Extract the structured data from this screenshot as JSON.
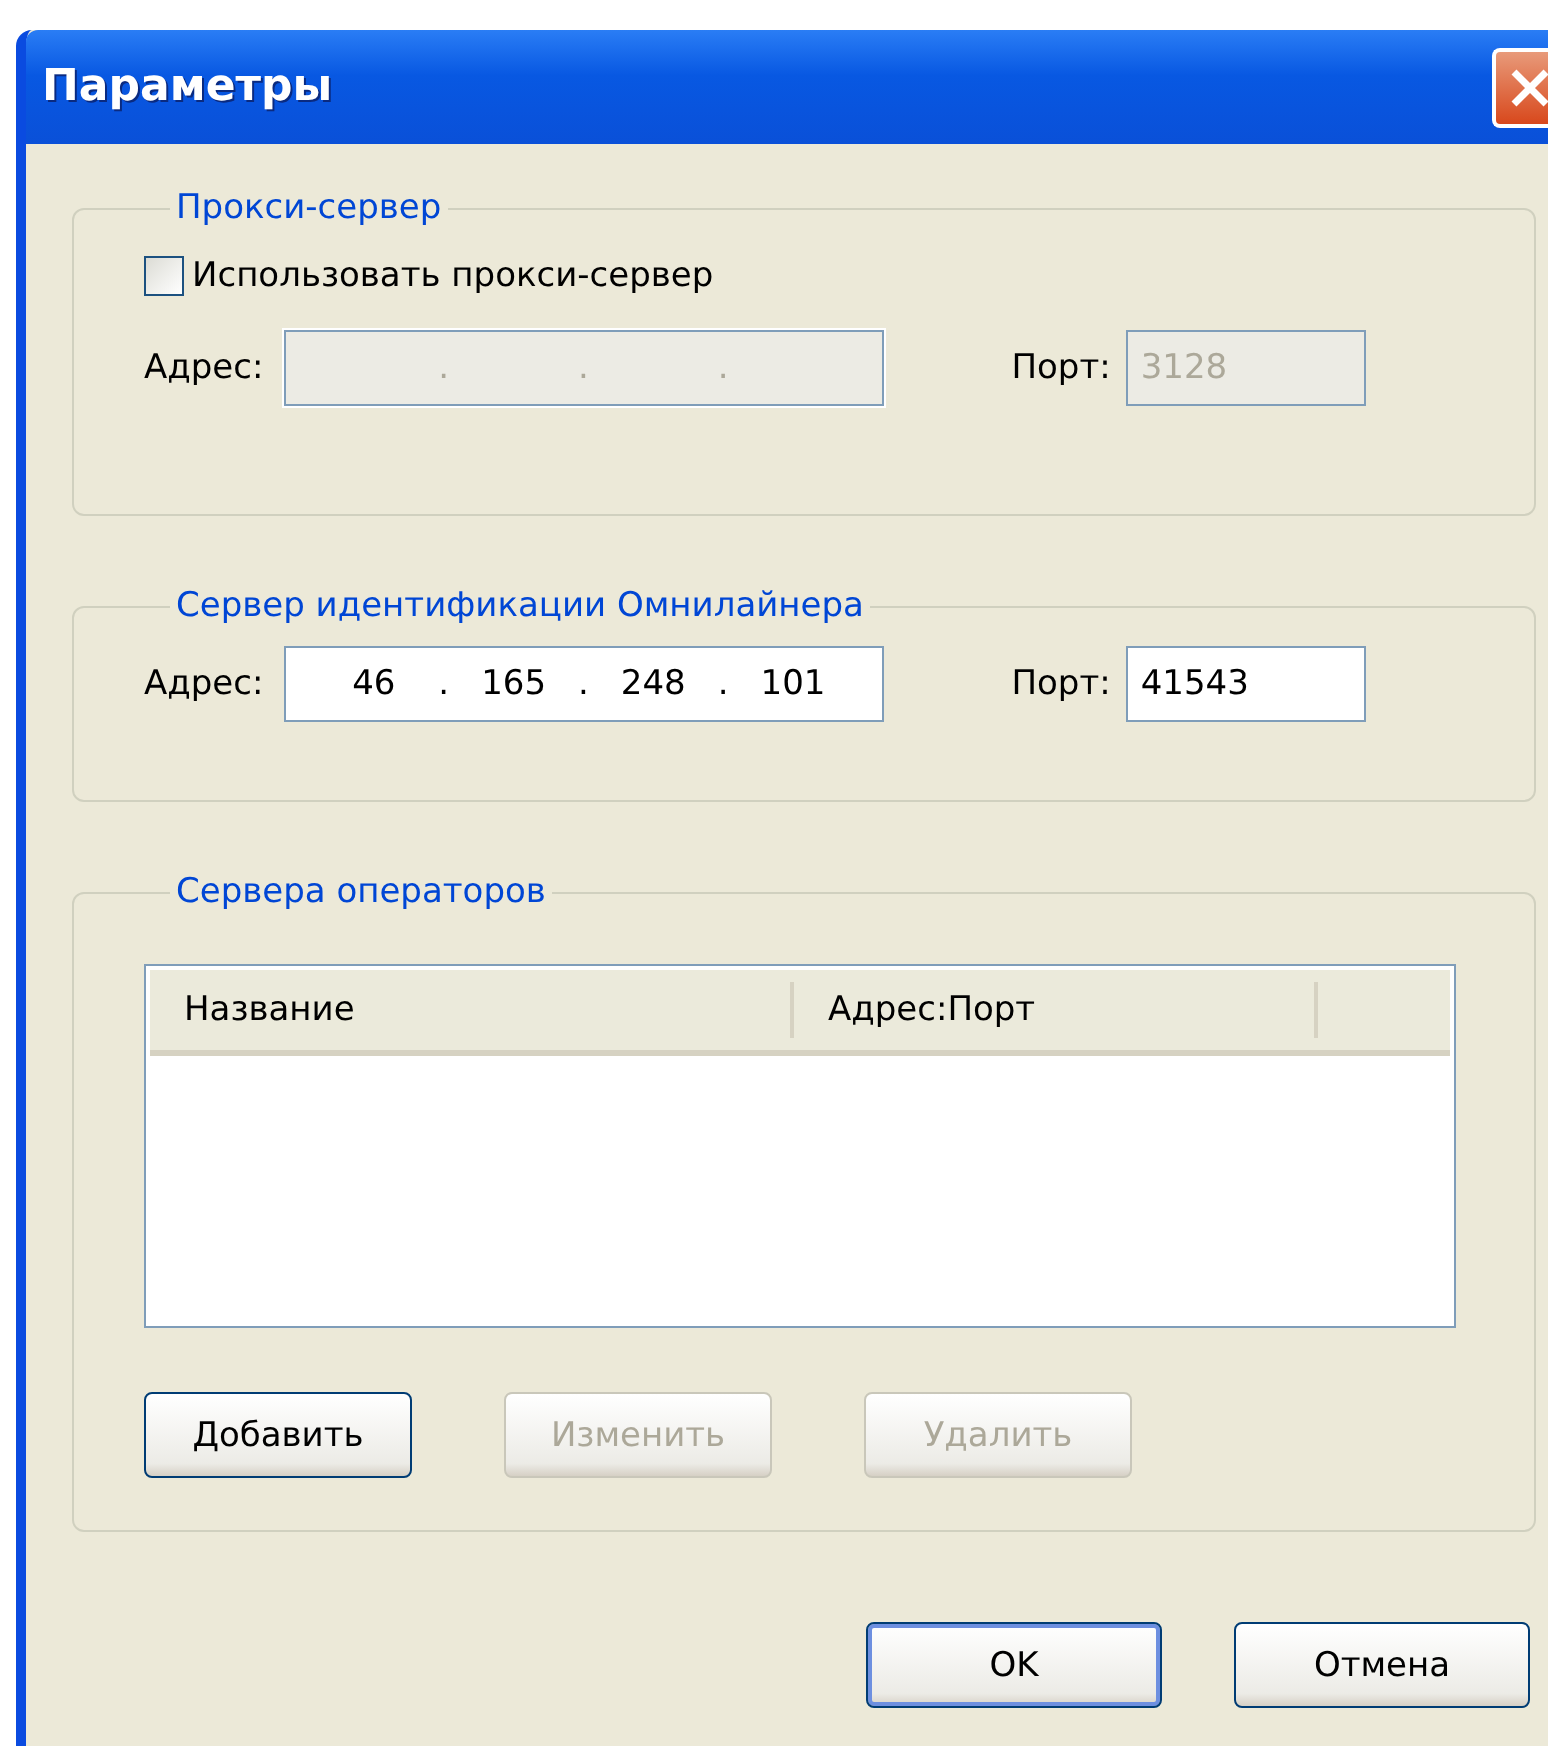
{
  "window": {
    "title": "Параметры"
  },
  "proxy": {
    "title": "Прокси-сервер",
    "use_proxy": {
      "label": "Использовать прокси-сервер",
      "checked": false
    },
    "address": {
      "label": "Адрес:",
      "separators": [
        ".",
        ".",
        "."
      ],
      "disabled": true
    },
    "port": {
      "label": "Порт:",
      "value": "3128",
      "disabled": true
    }
  },
  "auth_server": {
    "title": "Сервер идентификации Омнилайнера",
    "address": {
      "label": "Адрес:",
      "octets": [
        "46",
        "165",
        "248",
        "101"
      ],
      "separators": [
        ".",
        ".",
        "."
      ],
      "disabled": false
    },
    "port": {
      "label": "Порт:",
      "value": "41543",
      "disabled": false
    }
  },
  "operators": {
    "title": "Сервера операторов",
    "table": {
      "columns": [
        "Название",
        "Адрес:Порт"
      ]
    },
    "buttons": [
      {
        "label": "Добавить",
        "disabled": false
      },
      {
        "label": "Изменить",
        "disabled": true
      },
      {
        "label": "Удалить",
        "disabled": true
      }
    ]
  },
  "footer_buttons": [
    {
      "label": "OK",
      "default": true
    },
    {
      "label": "Отмена",
      "default": false
    }
  ]
}
